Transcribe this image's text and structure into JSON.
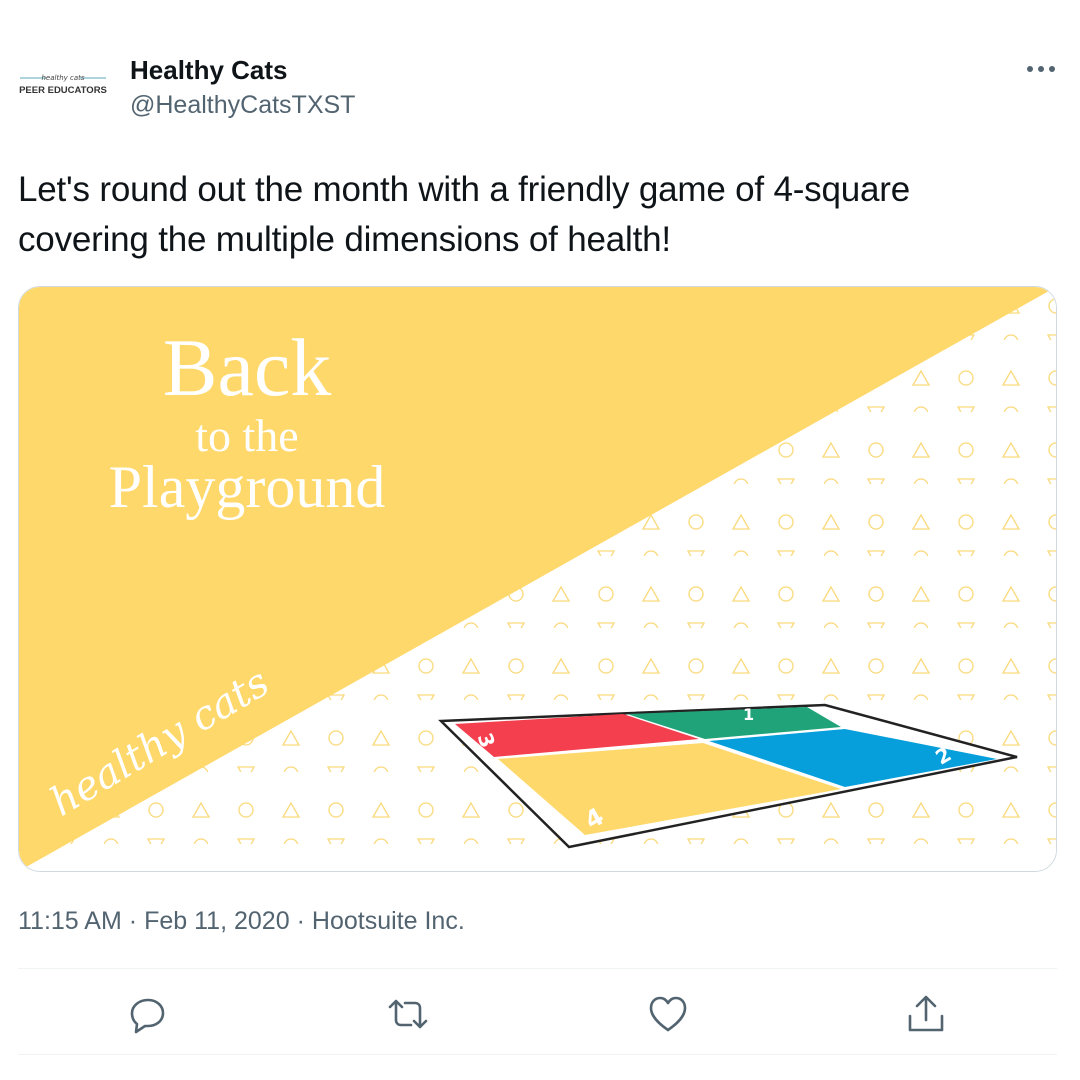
{
  "author": {
    "name": "Healthy Cats",
    "handle": "@HealthyCatsTXST",
    "avatar_text_top": "healthy cats",
    "avatar_text_bottom": "PEER EDUCATORS"
  },
  "tweet": {
    "text": "Let's round out the month with a friendly game of 4-square covering the multiple dimensions of health!"
  },
  "media": {
    "title_line1": "Back",
    "title_line2": "to the",
    "title_line3": "Playground",
    "logo_text": "healthy cats",
    "square_numbers": [
      "1",
      "2",
      "3",
      "4"
    ],
    "colors": {
      "yellow_band": "#fed86a",
      "pattern": "#f9d97a",
      "square_red": "#f43f4e",
      "square_green": "#21a37a",
      "square_blue": "#079fdb",
      "square_yellow": "#fed86a"
    }
  },
  "meta": {
    "time": "11:15 AM",
    "separator": "·",
    "date": "Feb 11, 2020",
    "source": "Hootsuite Inc."
  },
  "actions": {
    "reply_icon": "reply-icon",
    "retweet_icon": "retweet-icon",
    "like_icon": "like-icon",
    "share_icon": "share-icon",
    "more_icon": "more-icon"
  },
  "colors": {
    "text_primary": "#0f1419",
    "text_secondary": "#536471",
    "border": "#cfd9de",
    "divider": "#eff3f4"
  }
}
